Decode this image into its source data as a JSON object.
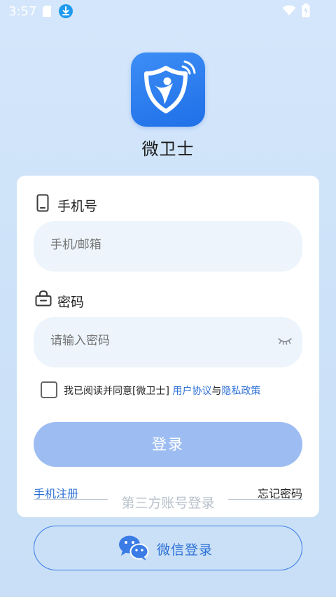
{
  "status_bar": {
    "time": "3:57",
    "icons": [
      "sd-card-icon",
      "download-icon",
      "wifi-icon",
      "battery-icon"
    ]
  },
  "app": {
    "name": "微卫士",
    "logo_icon": "shield-person-icon",
    "brand_color": "#2577ee"
  },
  "login_form": {
    "phone_label": "手机号",
    "phone_icon": "phone-icon",
    "phone_placeholder": "手机/邮箱",
    "password_label": "密码",
    "password_icon": "lock-icon",
    "password_placeholder": "请输入密码",
    "password_toggle_icon": "eye-closed-icon",
    "agreement": {
      "prefix": "我已阅读并同意[微卫士] ",
      "user_agreement": "用户协议",
      "connector": "与",
      "privacy_policy": "隐私政策",
      "checked": false
    },
    "login_button": "登录",
    "phone_register": "手机注册",
    "third_party_label": "第三方账号登录",
    "forgot_password": "忘记密码"
  },
  "wechat_login": {
    "label": "微信登录",
    "icon": "wechat-icon"
  },
  "colors": {
    "accent": "#2b6fd6",
    "login_button_bg": "#9dbdf2",
    "input_bg": "#edf4fc",
    "page_bg": "#cde2f8"
  }
}
